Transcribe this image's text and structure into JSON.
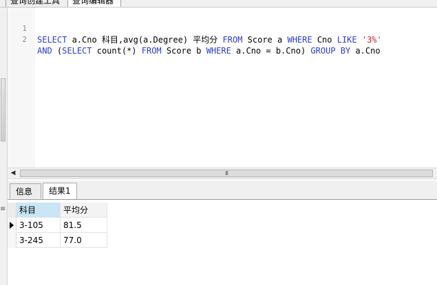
{
  "top_tabs": {
    "tab1": "查询创建工具",
    "tab2": "查询编辑器"
  },
  "editor": {
    "lines": [
      {
        "num": "1",
        "tokens": [
          "SELECT",
          " a.Cno 科目,avg(a.Degree) 平均分 ",
          "FROM",
          " Score a ",
          "WHERE",
          " Cno ",
          "LIKE",
          " ",
          "'3%'"
        ]
      },
      {
        "num": "2",
        "tokens": [
          "AND",
          " (",
          "SELECT",
          " count(*) ",
          "FROM",
          " Score b ",
          "WHERE",
          " a.Cno = b.Cno) ",
          "GROUP BY",
          " a.Cno"
        ]
      }
    ]
  },
  "scrollbar": {
    "grip": "III"
  },
  "result_tabs": {
    "info": "信息",
    "result1": "结果1"
  },
  "grid": {
    "columns": [
      "科目",
      "平均分"
    ],
    "rows": [
      [
        "3-105",
        "81.5"
      ],
      [
        "3-245",
        "77.0"
      ]
    ]
  },
  "colors": {
    "keyword": "#2a3cd6",
    "string": "#c32a2a",
    "header_selected": "#c9e6f7"
  }
}
